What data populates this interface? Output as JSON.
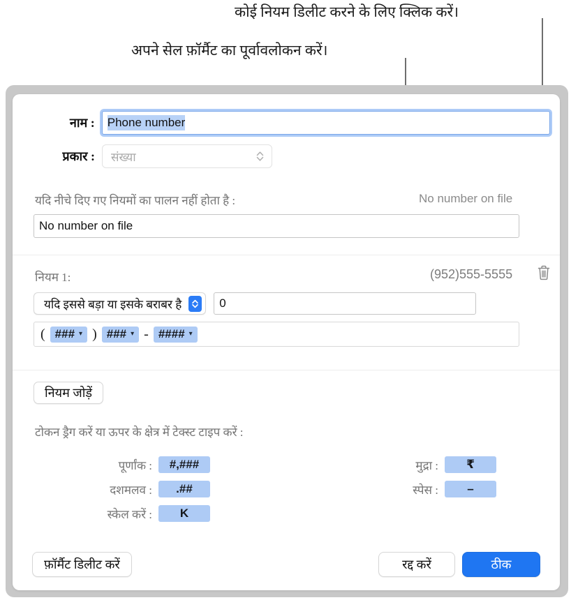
{
  "annotations": {
    "delete_rule": "कोई नियम डिलीट करने के लिए क्लिक करें।",
    "preview_format": "अपने सेल फ़ॉर्मैट का पूर्वावलोकन करें।"
  },
  "dialog": {
    "name": {
      "label": "नाम :",
      "value": "Phone number"
    },
    "type": {
      "label": "प्रकार :",
      "value": "संख्या"
    },
    "fallback": {
      "label": "यदि नीचे दिए गए नियमों का पालन नहीं होता है :",
      "value": "No number on file",
      "preview": "No number on file"
    },
    "rule": {
      "label": "नियम 1:",
      "preview": "(952)555-5555",
      "condition": "यदि इससे बड़ा या इसके बराबर है",
      "threshold": "0",
      "delete_icon": "trash-icon",
      "format_tokens": [
        {
          "kind": "literal",
          "text": "("
        },
        {
          "kind": "token",
          "text": "###"
        },
        {
          "kind": "literal",
          "text": ")"
        },
        {
          "kind": "token",
          "text": "###"
        },
        {
          "kind": "literal",
          "text": "-"
        },
        {
          "kind": "token",
          "text": "####"
        }
      ]
    },
    "add_rule_label": "नियम जोड़ें",
    "token_hint": "टोकन ड्रैग करें या ऊपर के क्षेत्र में टेक्स्ट टाइप करें :",
    "palette": {
      "integer": {
        "label": "पूर्णांक :",
        "token": "#,###"
      },
      "decimal": {
        "label": "दशमलव :",
        "token": ".##"
      },
      "scale": {
        "label": "स्केल करें :",
        "token": "K"
      },
      "currency": {
        "label": "मुद्रा :",
        "token": "₹"
      },
      "space": {
        "label": "स्पेस :",
        "token": "–"
      }
    },
    "footer": {
      "delete_format": "फ़ॉर्मैट डिलीट करें",
      "cancel": "रद्द करें",
      "ok": "ठीक"
    }
  },
  "colors": {
    "accent": "#1f76f2",
    "token_bg": "#aecbf5",
    "focus_ring": "#6aa0f0",
    "frame": "#c8c8c8"
  }
}
